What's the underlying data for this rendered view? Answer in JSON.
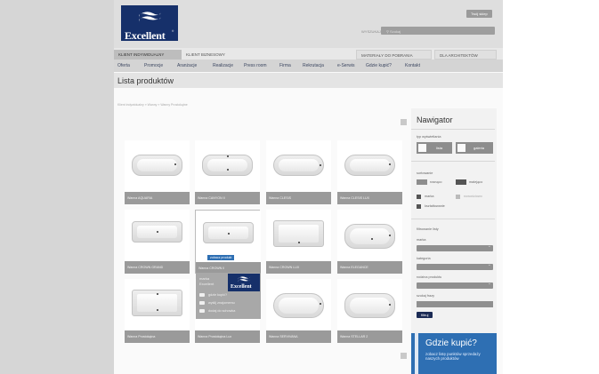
{
  "brand": {
    "name": "Excellent",
    "reg": "®"
  },
  "top": {
    "top_right_button": "Twój sklep",
    "search_label": "WYSZUKAJ",
    "search_placeholder": "Szukaj"
  },
  "audience_tabs": [
    "KLIENT INDYWIDUALNY",
    "KLIENT BIZNESOWY"
  ],
  "right_tabs": [
    "MATERIAŁY DO POBRANIA",
    "DLA ARCHITEKTÓW"
  ],
  "nav": [
    "Oferta",
    "Promocje",
    "Aranżacje",
    "Realizacje",
    "Press room",
    "Firma",
    "Rekrutacja",
    "e-Serwis",
    "Gdzie kupić?",
    "Kontakt"
  ],
  "page_title": "Lista produktów",
  "breadcrumb": "Klient indywidualny » Wanny » Wanny Prostokątne",
  "products": [
    {
      "label": "Wanna AQUARIA"
    },
    {
      "label": "Wanna CANYON II"
    },
    {
      "label": "Wanna CLESIS"
    },
    {
      "label": "Wanna CLESIS LUX"
    },
    {
      "label": "Wanna CROWN GRAND"
    },
    {
      "label": "Wanna CROWN II"
    },
    {
      "label": "Wanna CROWN LUX"
    },
    {
      "label": "Wanna ELEGANCE"
    },
    {
      "label": "Wanna Prostokątna"
    },
    {
      "label": "Wanna Prostokątna Lux"
    },
    {
      "label": "Wanna SERVIVANA"
    },
    {
      "label": "Wanna STELLAR 2"
    }
  ],
  "hover_card": {
    "badge": "zobacz produkt",
    "brand": "Excellent",
    "title_line1": "marka",
    "title_line2": "Excellent",
    "actions": [
      "gdzie kupić?",
      "wyślij znajomemu",
      "dodaj do schowka"
    ]
  },
  "navigator": {
    "title": "Nawigator",
    "view_type_label": "typ wyświetlania",
    "view_list": "lista",
    "view_gallery": "galeria",
    "sort_label": "sortowanie",
    "sort_asc": "rosnąco",
    "sort_desc": "malejąco",
    "sort_brand": "marka",
    "sort_new": "nowościowo",
    "sort_price": "kształtowanie",
    "filter_title": "filtrowanie listy",
    "filters": [
      "marka",
      "kategoria",
      "rodzina produktu",
      "szukaj frazy"
    ],
    "filter_button": "filtruj"
  },
  "where_to_buy": {
    "title": "Gdzie kupić?",
    "subtitle": "zobacz listę punktów sprzedaży naszych produktów"
  },
  "colors": {
    "brand_navy": "#16306a",
    "accent_blue": "#2e6fb3"
  }
}
